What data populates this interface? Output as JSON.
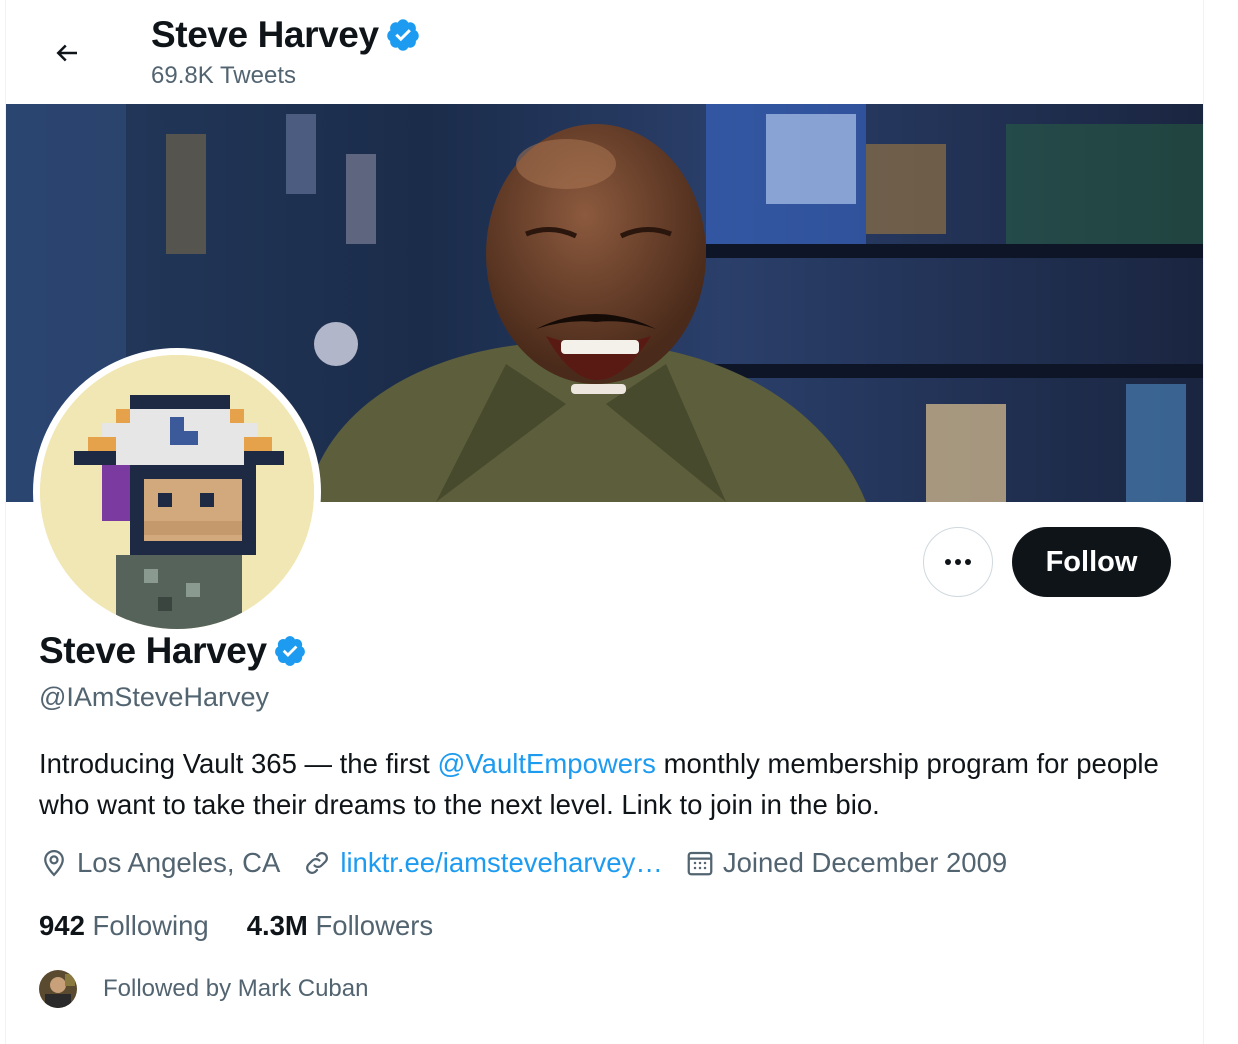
{
  "header": {
    "title": "Steve Harvey",
    "tweet_count": "69.8K Tweets"
  },
  "profile": {
    "display_name": "Steve Harvey",
    "handle": "@IAmSteveHarvey",
    "bio": {
      "part1": "Introducing Vault 365 — the first ",
      "mention": "@VaultEmpowers",
      "part2": " monthly membership program for people who want to take their dreams to the next level. Link to join in the bio."
    },
    "location": "Los Angeles, CA",
    "website": "linktr.ee/iamsteveharvey…",
    "joined": "Joined December 2009",
    "following_count": "942",
    "following_label": "Following",
    "followers_count": "4.3M",
    "followers_label": "Followers",
    "followed_by": "Followed by Mark Cuban"
  },
  "actions": {
    "more_label": "•••",
    "follow_label": "Follow"
  },
  "icons": {
    "back": "back-arrow-icon",
    "verified": "verified-badge-icon",
    "location": "location-pin-icon",
    "link": "link-icon",
    "calendar": "calendar-icon",
    "more": "more-icon"
  },
  "colors": {
    "accent": "#1d9bf0",
    "text": "#0f1419",
    "secondary": "#536471",
    "follow_button": "#0f1419"
  }
}
